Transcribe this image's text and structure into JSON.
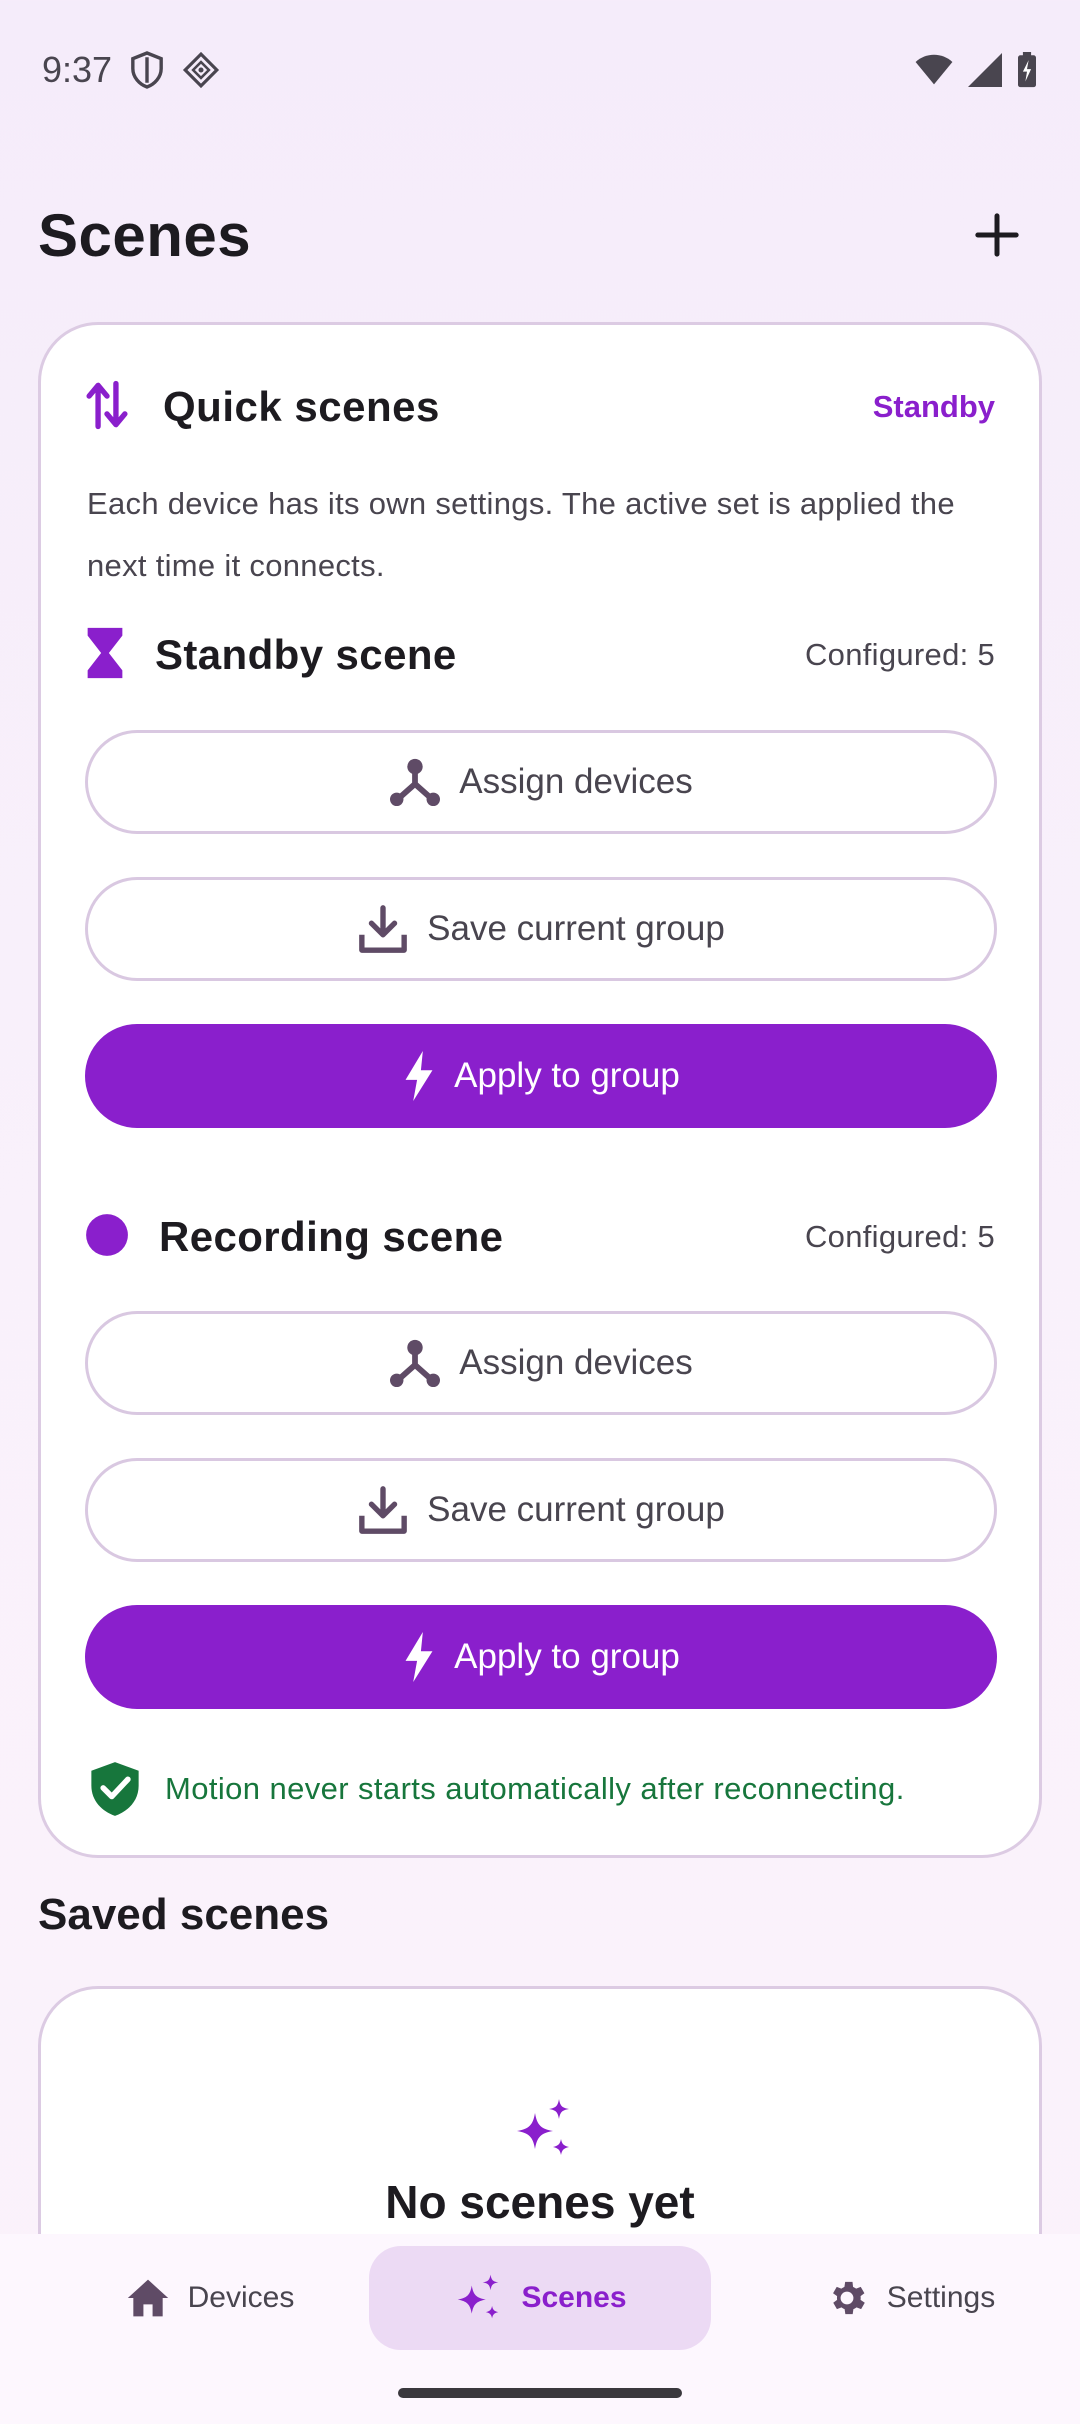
{
  "status_bar": {
    "time": "9:37"
  },
  "header": {
    "title": "Scenes"
  },
  "quick_scenes": {
    "title": "Quick scenes",
    "status": "Standby",
    "description": "Each device has its own settings. The active set is applied the next time it connects.",
    "scenes": [
      {
        "title": "Standby scene",
        "configured": "Configured: 5",
        "assign_label": "Assign devices",
        "save_label": "Save current group",
        "apply_label": "Apply to group"
      },
      {
        "title": "Recording scene",
        "configured": "Configured: 5",
        "assign_label": "Assign devices",
        "save_label": "Save current group",
        "apply_label": "Apply to group"
      }
    ],
    "note": "Motion never starts automatically after reconnecting."
  },
  "saved_scenes": {
    "title": "Saved scenes",
    "empty_title": "No scenes yet"
  },
  "bottom_nav": {
    "items": [
      {
        "label": "Devices",
        "icon": "home-icon"
      },
      {
        "label": "Scenes",
        "icon": "sparkle-icon",
        "active": true
      },
      {
        "label": "Settings",
        "icon": "gear-icon"
      }
    ]
  },
  "colors": {
    "accent": "#8a1fcc",
    "success": "#17763c",
    "text_secondary": "#49454f",
    "outline": "#d9c8e1"
  }
}
